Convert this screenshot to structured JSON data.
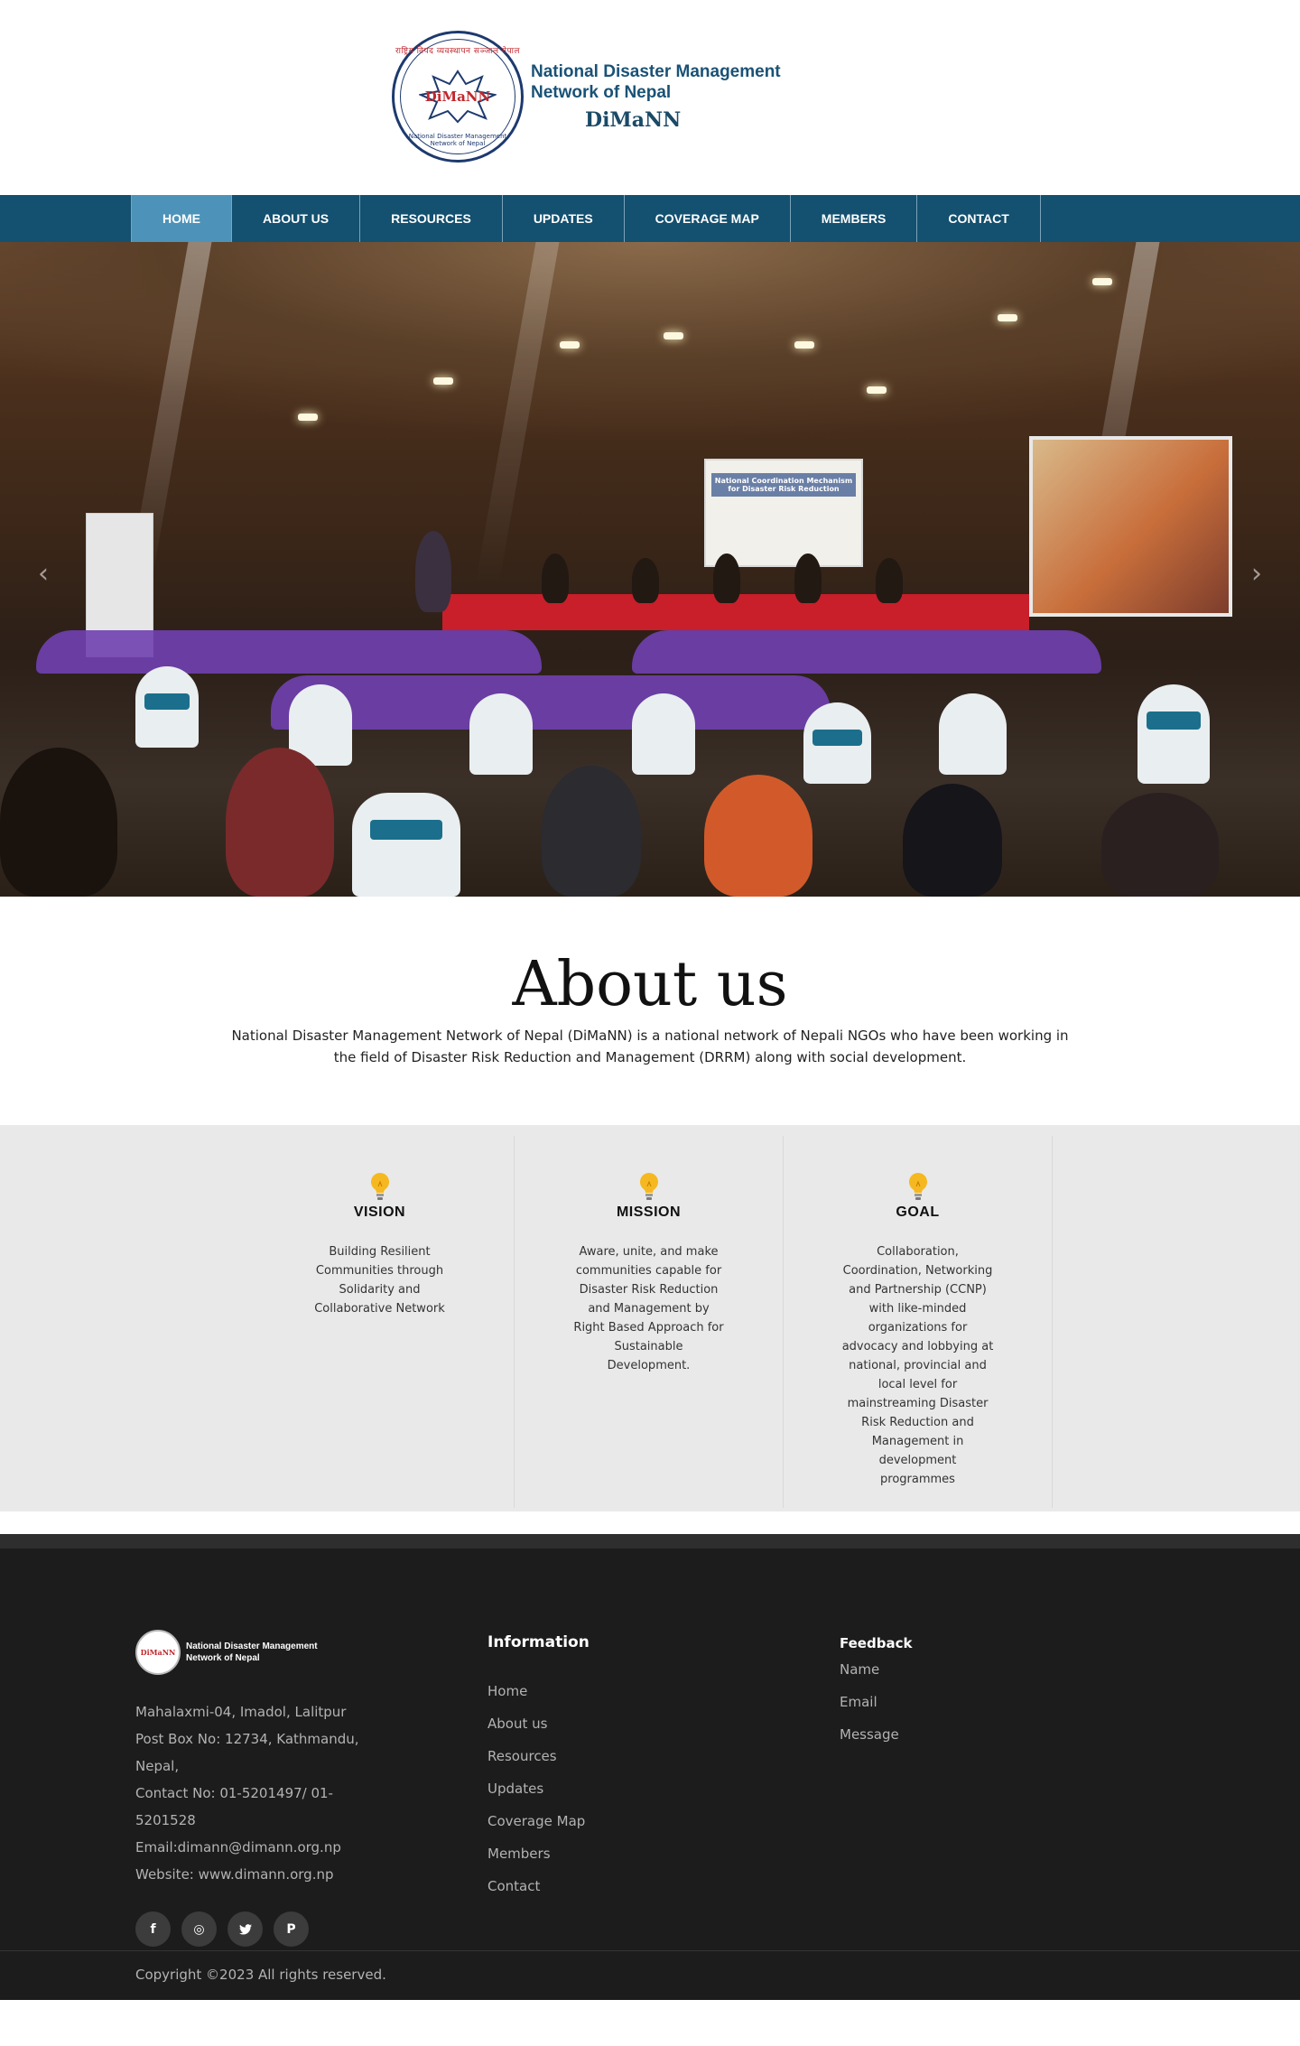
{
  "header": {
    "emblem_mark": "DiMaNN",
    "emblem_ring_top": "राष्ट्रिय विपद व्यवस्थापन सञ्जाल नेपाल",
    "emblem_ring_bottom": "National Disaster Management Network of Nepal",
    "title_line1": "National Disaster Management",
    "title_line2": "Network of Nepal",
    "abbr": "DiMaNN"
  },
  "nav": {
    "items": [
      {
        "label": "HOME",
        "active": true
      },
      {
        "label": "ABOUT US",
        "active": false
      },
      {
        "label": "RESOURCES",
        "active": false
      },
      {
        "label": "UPDATES",
        "active": false
      },
      {
        "label": "COVERAGE MAP",
        "active": false
      },
      {
        "label": "MEMBERS",
        "active": false
      },
      {
        "label": "CONTACT",
        "active": false
      }
    ],
    "bar_color": "#14506f",
    "active_color": "#4d93b9"
  },
  "hero": {
    "banner_title": "National Coordination Mechanism for Disaster Risk Reduction",
    "prev_arrow": "‹",
    "next_arrow": "›"
  },
  "about": {
    "title": "About us",
    "text": "National Disaster Management Network of Nepal (DiMaNN) is a national network of Nepali NGOs who have been working in the field of Disaster Risk Reduction and Management (DRRM) along with social development."
  },
  "vmg": [
    {
      "icon": "lightbulb-icon",
      "title": "VISION",
      "text": "Building Resilient Communities through Solidarity and Collaborative Network"
    },
    {
      "icon": "lightbulb-icon",
      "title": "MISSION",
      "text": "Aware, unite, and make communities capable for Disaster Risk Reduction and Management by Right Based Approach for Sustainable Development."
    },
    {
      "icon": "lightbulb-icon",
      "title": "GOAL",
      "text": "Collaboration, Coordination, Networking and Partnership (CCNP) with like-minded organizations for advocacy and lobbying at national, provincial and local level for mainstreaming Disaster Risk Reduction and Management in development programmes"
    }
  ],
  "footer": {
    "logo_mark": "DiMaNN",
    "logo_line1": "National Disaster Management",
    "logo_line2": "Network of Nepal",
    "address_lines": [
      "Mahalaxmi-04, Imadol, Lalitpur",
      "Post Box No: 12734, Kathmandu, Nepal,",
      "Contact No: 01-5201497/ 01-5201528",
      "Email:dimann@dimann.org.np",
      "Website: www.dimann.org.np"
    ],
    "social": [
      {
        "icon": "facebook-icon",
        "glyph": "f"
      },
      {
        "icon": "instagram-icon",
        "glyph": "◎"
      },
      {
        "icon": "twitter-icon",
        "glyph": "🐦"
      },
      {
        "icon": "pinterest-icon",
        "glyph": "P"
      }
    ],
    "info_heading": "Information",
    "info_links": [
      "Home",
      "About us",
      "Resources",
      "Updates",
      "Coverage Map",
      "Members",
      "Contact"
    ],
    "feedback_heading": "Feedback",
    "feedback_fields": [
      "Name",
      "Email",
      "Message"
    ],
    "copyright": "Copyright ©2023 All rights reserved."
  }
}
